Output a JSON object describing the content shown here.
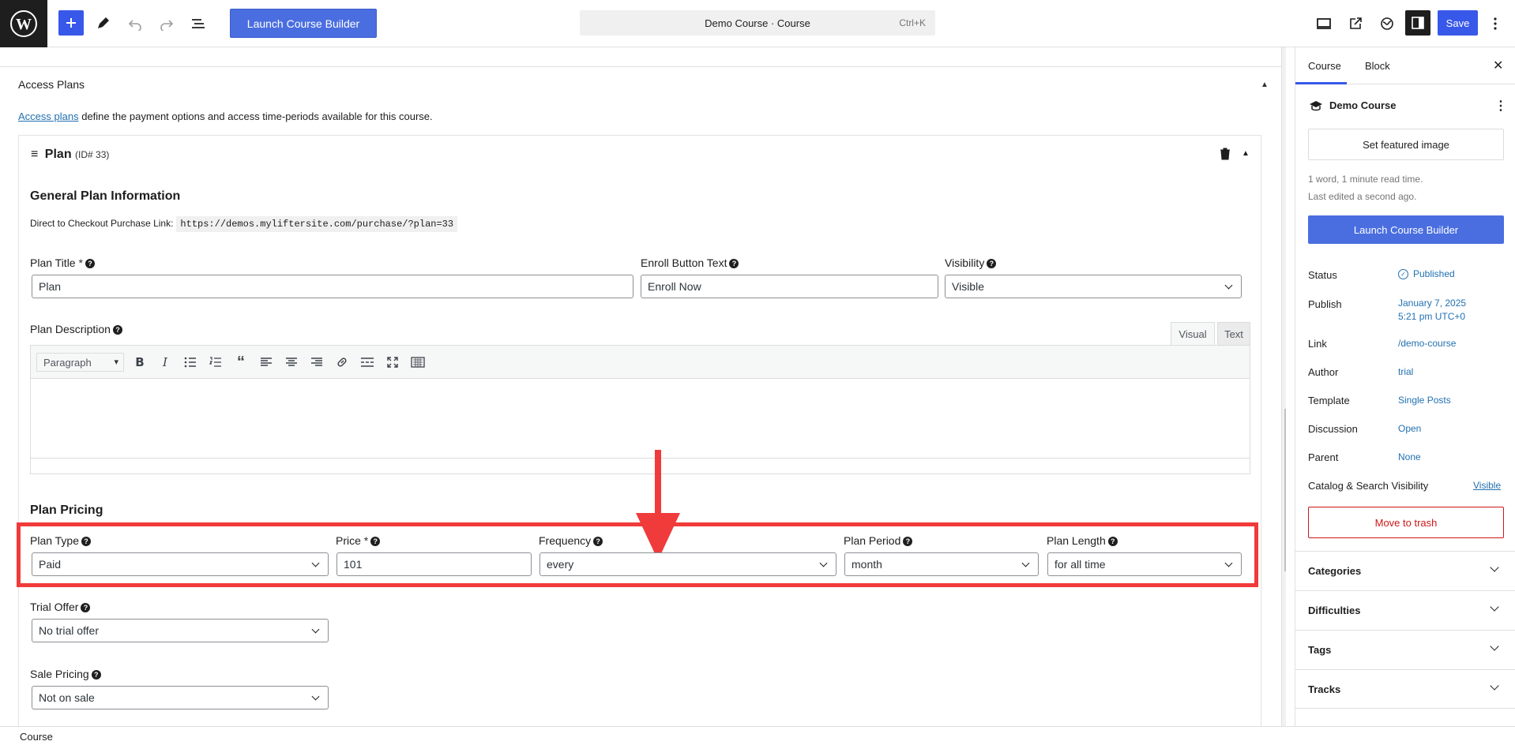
{
  "topbar": {
    "launch_label": "Launch Course Builder",
    "command_title": "Demo Course · Course",
    "command_shortcut": "Ctrl+K",
    "save_label": "Save"
  },
  "access": {
    "title": "Access Plans",
    "link_text": "Access plans",
    "desc_rest": "define the payment options and access time-periods available for this course."
  },
  "plan": {
    "name": "Plan",
    "id_text": "(ID# 33)",
    "general_title": "General Plan Information",
    "direct_label": "Direct to Checkout Purchase Link:",
    "direct_url": "https://demos.mylifter site.com/purchase/?plan=33",
    "title_label": "Plan Title",
    "title_value": "Plan",
    "enroll_label": "Enroll Button Text",
    "enroll_value": "Enroll Now",
    "visibility_label": "Visibility",
    "visibility_value": "Visible",
    "desc_label": "Plan Description",
    "tab_visual": "Visual",
    "tab_text": "Text",
    "format_value": "Paragraph",
    "pricing_title": "Plan Pricing",
    "type_label": "Plan Type",
    "type_value": "Paid",
    "price_label": "Price",
    "price_value": "101",
    "frequency_label": "Frequency",
    "frequency_value": "every",
    "period_label": "Plan Period",
    "period_value": "month",
    "length_label": "Plan Length",
    "length_value": "for all time",
    "trial_label": "Trial Offer",
    "trial_value": "No trial offer",
    "sale_label": "Sale Pricing",
    "sale_value": "Not on sale",
    "required_mark": "*"
  },
  "sidebar": {
    "tab_course": "Course",
    "tab_block": "Block",
    "course_title": "Demo Course",
    "featured_label": "Set featured image",
    "meta_words": "1 word, 1 minute read time.",
    "meta_edited": "Last edited a second ago.",
    "launch_label": "Launch Course Builder",
    "rows": [
      {
        "label": "Status",
        "value": "Published"
      },
      {
        "label": "Publish",
        "value": "January 7, 2025"
      },
      {
        "label": "Link",
        "value": "/demo-course"
      },
      {
        "label": "Author",
        "value": "trial"
      },
      {
        "label": "Template",
        "value": "Single Posts"
      },
      {
        "label": "Discussion",
        "value": "Open"
      },
      {
        "label": "Parent",
        "value": "None"
      }
    ],
    "publish_time": "5:21 pm UTC+0",
    "catalog_label": "Catalog & Search Visibility",
    "catalog_value": "Visible",
    "trash_label": "Move to trash",
    "panels": [
      "Categories",
      "Difficulties",
      "Tags",
      "Tracks"
    ]
  },
  "bottombar": {
    "crumb": "Course"
  },
  "colors": {
    "accent": "#3858e9",
    "highlight": "#f13a3a",
    "link": "#2271b1",
    "danger": "#cc1818"
  }
}
